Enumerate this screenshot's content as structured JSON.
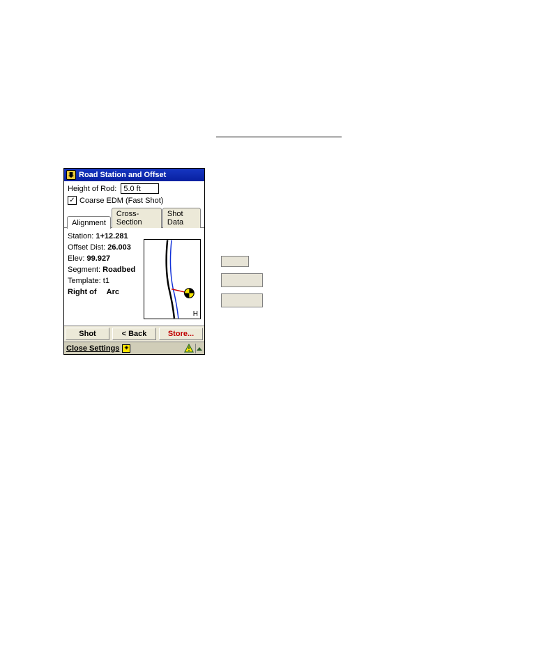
{
  "titlebar": {
    "title": "Road Station and Offset"
  },
  "upper": {
    "height_of_rod_label": "Height of Rod:",
    "height_of_rod_value": "5.0 ft",
    "coarse_edm_label": "Coarse EDM (Fast Shot)",
    "coarse_edm_checked": "✓"
  },
  "tabs": {
    "alignment": "Alignment",
    "cross_section": "Cross-Section",
    "shot_data": "Shot Data"
  },
  "alignment": {
    "station_label": "Station:",
    "station_value": "1+12.281",
    "offset_label": "Offset Dist:",
    "offset_value": "26.003",
    "elev_label": "Elev:",
    "elev_value": "99.927",
    "segment_label": "Segment:",
    "segment_value": "Roadbed",
    "template_label": "Template:",
    "template_value": "t1",
    "side_label": "Right of",
    "side_value": "Arc",
    "preview_h": "H"
  },
  "buttons": {
    "shot": "Shot",
    "back": "< Back",
    "store": "Store..."
  },
  "status": {
    "close_settings": "Close Settings",
    "star": "✷"
  }
}
